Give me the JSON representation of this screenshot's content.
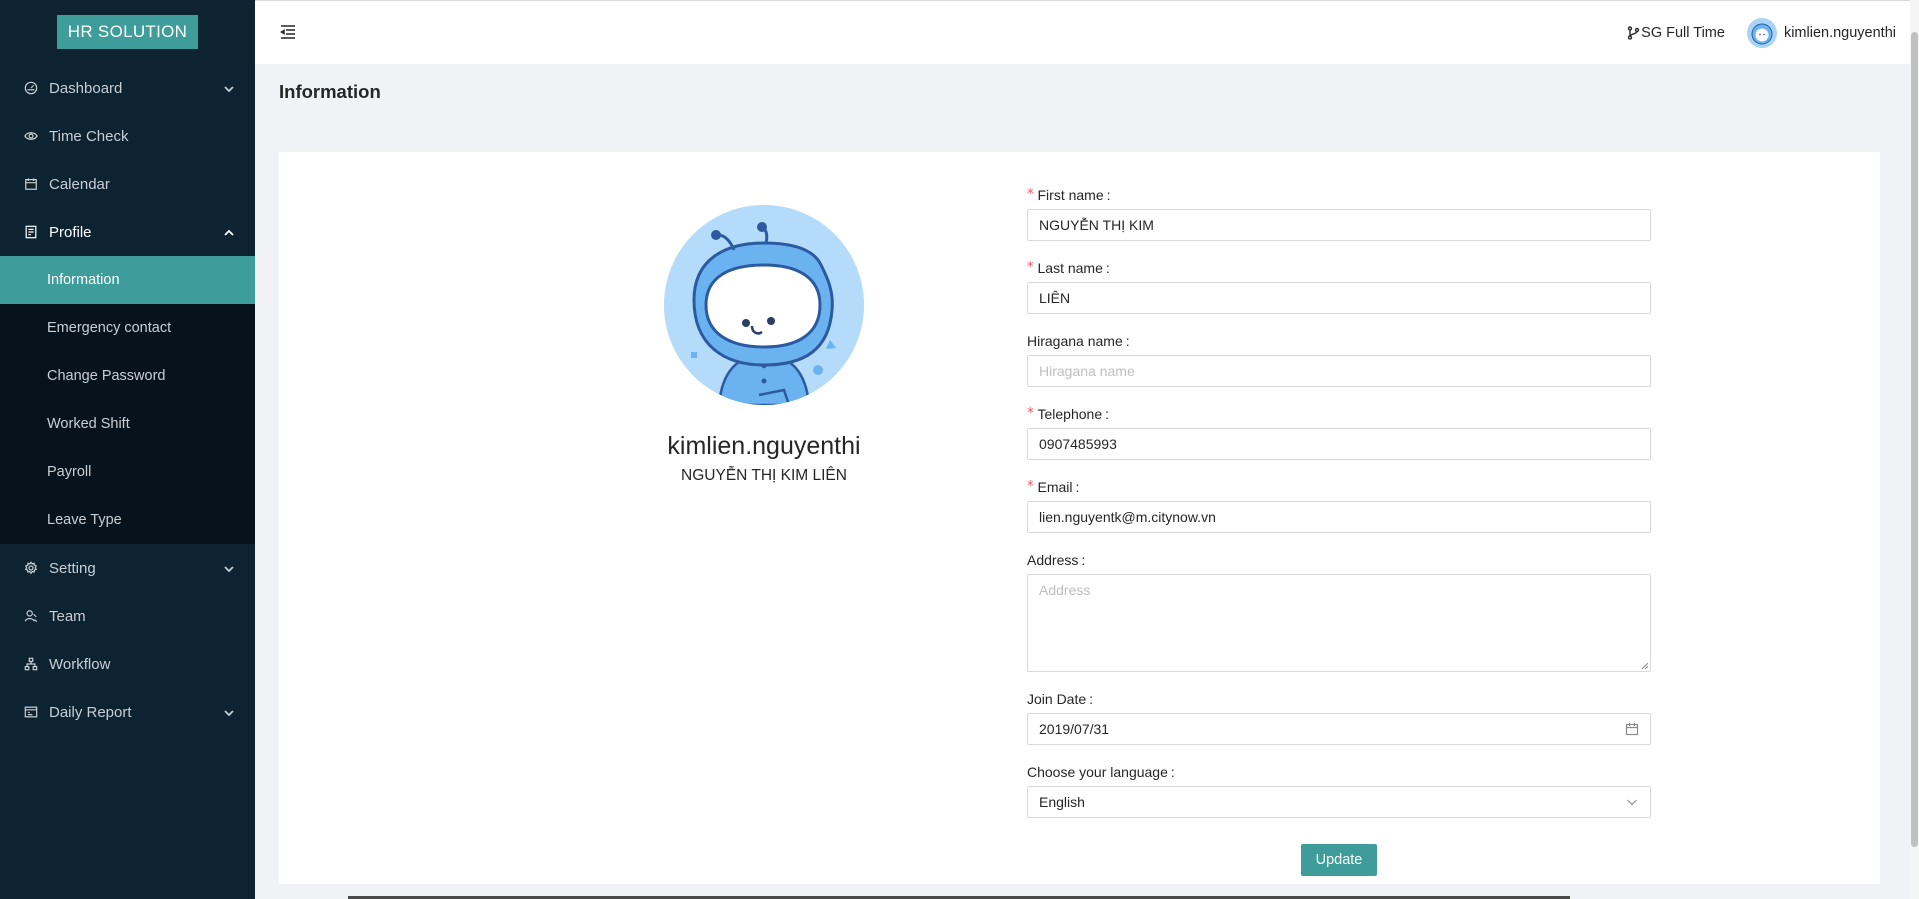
{
  "app": {
    "logo": "HR SOLUTION"
  },
  "sidebar": {
    "items": [
      {
        "label": "Dashboard",
        "icon": "dashboard-icon",
        "has_arrow": true
      },
      {
        "label": "Time Check",
        "icon": "eye-icon"
      },
      {
        "label": "Calendar",
        "icon": "calendar-icon"
      },
      {
        "label": "Profile",
        "icon": "profile-icon",
        "open": true
      }
    ],
    "profile_submenu": [
      {
        "label": "Information",
        "active": true
      },
      {
        "label": "Emergency contact"
      },
      {
        "label": "Change Password"
      },
      {
        "label": "Worked Shift"
      },
      {
        "label": "Payroll"
      },
      {
        "label": "Leave Type"
      }
    ],
    "items_after": [
      {
        "label": "Setting",
        "icon": "gear-icon",
        "has_arrow": true
      },
      {
        "label": "Team",
        "icon": "team-icon"
      },
      {
        "label": "Workflow",
        "icon": "workflow-icon"
      },
      {
        "label": "Daily Report",
        "icon": "report-icon",
        "has_arrow": true
      }
    ]
  },
  "header": {
    "branch": "SG Full Time",
    "username": "kimlien.nguyenthi"
  },
  "page": {
    "title": "Information"
  },
  "profile": {
    "username": "kimlien.nguyenthi",
    "fullname": "NGUYỄN THỊ KIM LIÊN"
  },
  "form": {
    "first_name": {
      "label": "First name",
      "value": "NGUYỄN THỊ KIM",
      "required": true
    },
    "last_name": {
      "label": "Last name",
      "value": "LIÊN",
      "required": true
    },
    "hiragana": {
      "label": "Hiragana name",
      "placeholder": "Hiragana name"
    },
    "telephone": {
      "label": "Telephone",
      "value": "0907485993",
      "required": true
    },
    "email": {
      "label": "Email",
      "value": "lien.nguyentk@m.citynow.vn",
      "required": true
    },
    "address": {
      "label": "Address",
      "placeholder": "Address"
    },
    "join_date": {
      "label": "Join Date",
      "value": "2019/07/31"
    },
    "language": {
      "label": "Choose your language",
      "value": "English"
    },
    "submit": "Update"
  },
  "colors": {
    "sidebar_bg": "#0d2332",
    "accent": "#3e9c9a",
    "required": "#ff4d4f"
  }
}
